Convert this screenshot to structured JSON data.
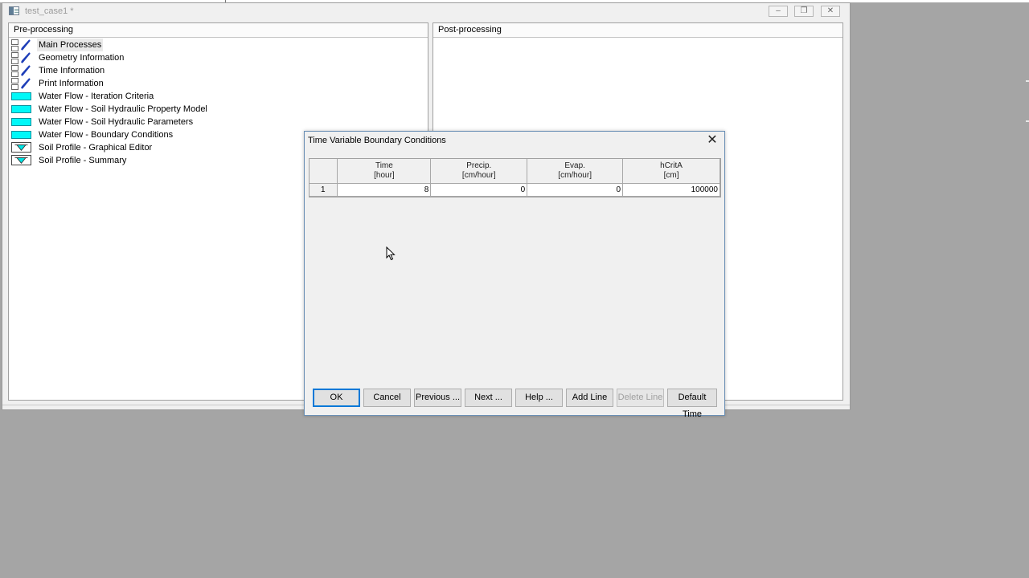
{
  "window": {
    "title": "test_case1 *",
    "controls": [
      "minimize",
      "restore",
      "close"
    ]
  },
  "pre_processing": {
    "header": "Pre-processing",
    "items": [
      {
        "label": "Main Processes",
        "icon": "pen-checkbox-icon",
        "selected": true
      },
      {
        "label": "Geometry Information",
        "icon": "pen-checkbox-icon"
      },
      {
        "label": "Time Information",
        "icon": "pen-checkbox-icon"
      },
      {
        "label": "Print Information",
        "icon": "pen-checkbox-icon"
      },
      {
        "label": "Water Flow - Iteration Criteria",
        "icon": "water-flow-icon"
      },
      {
        "label": "Water Flow - Soil Hydraulic Property Model",
        "icon": "water-flow-icon"
      },
      {
        "label": "Water Flow - Soil Hydraulic Parameters",
        "icon": "water-flow-icon"
      },
      {
        "label": "Water Flow - Boundary Conditions",
        "icon": "water-flow-icon"
      },
      {
        "label": "Soil Profile - Graphical Editor",
        "icon": "soil-profile-icon"
      },
      {
        "label": "Soil Profile - Summary",
        "icon": "soil-profile-icon"
      }
    ]
  },
  "post_processing": {
    "header": "Post-processing"
  },
  "dialog": {
    "title": "Time Variable Boundary Conditions",
    "columns": [
      {
        "name": "Time",
        "unit": "[hour]"
      },
      {
        "name": "Precip.",
        "unit": "[cm/hour]"
      },
      {
        "name": "Evap.",
        "unit": "[cm/hour]"
      },
      {
        "name": "hCritA",
        "unit": "[cm]"
      }
    ],
    "rows": [
      {
        "index": "1",
        "time": "8",
        "precip": "0",
        "evap": "0",
        "hcrita": "100000"
      }
    ],
    "buttons": {
      "ok": "OK",
      "cancel": "Cancel",
      "previous": "Previous ...",
      "next": "Next ...",
      "help": "Help ...",
      "add_line": "Add Line",
      "delete_line": "Delete Line",
      "default_time": "Default Time"
    }
  },
  "colors": {
    "desktop": "#a5a5a5",
    "water_flow_icon": "#00f8f8",
    "pen_icon": "#1f3fb8",
    "dialog_border": "#6a8fb5"
  }
}
